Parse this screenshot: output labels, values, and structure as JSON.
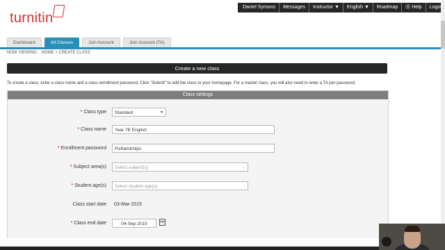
{
  "logo": {
    "text": "turnitin"
  },
  "user_nav": [
    "Daniel Symons",
    "Messages",
    "Instructor ▼",
    "English ▼",
    "Roadmap",
    "⓪ Help",
    "Logout"
  ],
  "tabs": [
    {
      "label": "Dashboard",
      "active": false
    },
    {
      "label": "All Classes",
      "active": true
    },
    {
      "label": "Join Account",
      "active": false
    },
    {
      "label": "Join Account (TA)",
      "active": false
    }
  ],
  "breadcrumb": {
    "prefix": "NOW VIEWING:",
    "path": "HOME > CREATE CLASS"
  },
  "page_title": "Create a new class",
  "instructions": "To create a class, enter a class name and a class enrollment password. Click \"Submit\" to add the class to your homepage. For a master class, you will also need to enter a TA join password.",
  "panel": {
    "title": "Class settings",
    "fields": {
      "class_type": {
        "label": "Class type",
        "value": "Standard"
      },
      "class_name": {
        "label": "Class name",
        "value": "Year 7E English"
      },
      "enrollment_password": {
        "label": "Enrollment password",
        "value": "Fishandchips"
      },
      "subject_areas": {
        "label": "Subject area(s)",
        "placeholder": "Select subject(s)"
      },
      "student_ages": {
        "label": "Student age(s)",
        "placeholder": "Select student age(s)"
      },
      "class_start_date": {
        "label": "Class start date",
        "value": "03-Mar-2015"
      },
      "class_end_date": {
        "label": "Class end date",
        "value": "04-Sep-2015"
      }
    }
  },
  "required_marker": "*",
  "colors": {
    "accent": "#2a8fb8",
    "brand": "#d32f2f",
    "dark_bar": "#262626",
    "panel_header": "#7d7d7d"
  }
}
